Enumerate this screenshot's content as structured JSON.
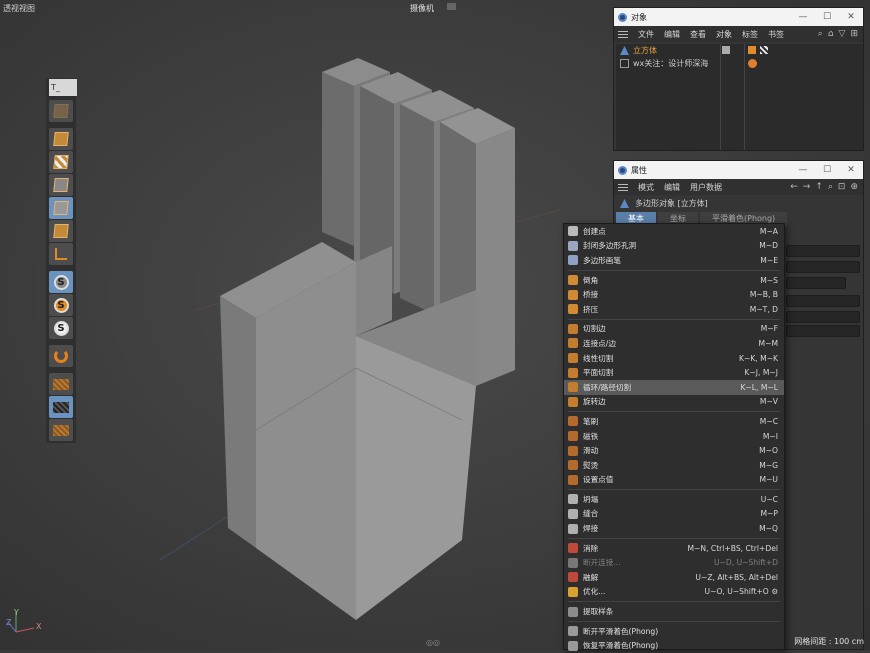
{
  "viewport": {
    "title": "透视视图",
    "camera": "摄像机",
    "grid_spacing": "网格间距 : 100 cm",
    "bottom_icon": "◎◎"
  },
  "toolbar": {
    "top_label": "T_",
    "items": [
      {
        "icon": "cube-faded-icon"
      },
      {
        "icon": "cube-model-icon"
      },
      {
        "icon": "cube-texture-icon"
      },
      {
        "icon": "cube-points-icon"
      },
      {
        "icon": "cube-edges-icon"
      },
      {
        "icon": "cube-polygons-icon"
      },
      {
        "icon": "axis-icon"
      },
      {
        "icon": "snap-icon",
        "label": "S"
      },
      {
        "icon": "snap-settings-icon",
        "label": "S"
      },
      {
        "icon": "snap-enable-icon",
        "label": "S"
      },
      {
        "icon": "magnet-icon"
      },
      {
        "icon": "grid-icon"
      },
      {
        "icon": "lock-grid-icon"
      },
      {
        "icon": "workplane-icon"
      }
    ]
  },
  "objects_panel": {
    "title": "对象",
    "window_buttons": [
      "—",
      "☐",
      "✕"
    ],
    "menu": [
      "文件",
      "编辑",
      "查看",
      "对象",
      "标签",
      "书签"
    ],
    "rows": [
      {
        "name": "立方体",
        "color": "#e8a640"
      },
      {
        "name": "wx关注：设计师深海",
        "color": "#c8c8c8"
      }
    ]
  },
  "attributes_panel": {
    "title": "属性",
    "window_buttons": [
      "—",
      "☐",
      "✕"
    ],
    "menu": [
      "模式",
      "编辑",
      "用户数据"
    ],
    "object_label": "多边形对象 [立方体]",
    "tabs": [
      "基本",
      "坐标",
      "平滑着色(Phong)"
    ]
  },
  "context_menu": {
    "groups": [
      [
        {
          "label": "创建点",
          "shortcut": "M~A",
          "icon_color": "#b9b9b9"
        },
        {
          "label": "封闭多边形孔洞",
          "shortcut": "M~D",
          "icon_color": "#9aa7bf"
        },
        {
          "label": "多边形画笔",
          "shortcut": "M~E",
          "icon_color": "#8fa0c6"
        }
      ],
      [
        {
          "label": "倒角",
          "shortcut": "M~S",
          "icon_color": "#d08a33"
        },
        {
          "label": "桥接",
          "shortcut": "M~B, B",
          "icon_color": "#d08a33"
        },
        {
          "label": "挤压",
          "shortcut": "M~T, D",
          "icon_color": "#d08a33"
        }
      ],
      [
        {
          "label": "切割边",
          "shortcut": "M~F",
          "icon_color": "#c47d2e"
        },
        {
          "label": "连接点/边",
          "shortcut": "M~M",
          "icon_color": "#c47d2e"
        },
        {
          "label": "线性切割",
          "shortcut": "K~K, M~K",
          "icon_color": "#c47d2e"
        },
        {
          "label": "平面切割",
          "shortcut": "K~J, M~J",
          "icon_color": "#c47d2e"
        },
        {
          "label": "循环/路径切割",
          "shortcut": "K~L, M~L",
          "icon_color": "#c47d2e",
          "highlight": true
        },
        {
          "label": "旋转边",
          "shortcut": "M~V",
          "icon_color": "#c47d2e"
        }
      ],
      [
        {
          "label": "笔刷",
          "shortcut": "M~C",
          "icon_color": "#b36a2a"
        },
        {
          "label": "磁铁",
          "shortcut": "M~I",
          "icon_color": "#b36a2a"
        },
        {
          "label": "滑动",
          "shortcut": "M~O",
          "icon_color": "#b36a2a"
        },
        {
          "label": "熨烫",
          "shortcut": "M~G",
          "icon_color": "#b36a2a"
        },
        {
          "label": "设置点值",
          "shortcut": "M~U",
          "icon_color": "#b36a2a"
        }
      ],
      [
        {
          "label": "坍塌",
          "shortcut": "U~C",
          "icon_color": "#b0b0b0"
        },
        {
          "label": "缝合",
          "shortcut": "M~P",
          "icon_color": "#b0b0b0"
        },
        {
          "label": "焊接",
          "shortcut": "M~Q",
          "icon_color": "#b0b0b0"
        }
      ],
      [
        {
          "label": "消除",
          "shortcut": "M~N, Ctrl+BS, Ctrl+Del",
          "icon_color": "#c04a3a"
        },
        {
          "label": "断开连接...",
          "shortcut": "U~D, U~Shift+D",
          "icon_color": "#777777",
          "disabled": true
        },
        {
          "label": "融解",
          "shortcut": "U~Z, Alt+BS, Alt+Del",
          "icon_color": "#c04a3a"
        },
        {
          "label": "优化...",
          "shortcut": "U~O, U~Shift+O ⚙",
          "icon_color": "#d9a12f"
        }
      ],
      [
        {
          "label": "提取样条",
          "shortcut": "",
          "icon_color": "#8c8c8c"
        }
      ],
      [
        {
          "label": "断开平滑着色(Phong)",
          "shortcut": "",
          "icon_color": "#9a9a9a"
        },
        {
          "label": "恢复平滑着色(Phong)",
          "shortcut": "",
          "icon_color": "#9a9a9a"
        }
      ]
    ]
  },
  "axis_gizmo": {
    "x": "X",
    "y": "Y",
    "z": "Z"
  }
}
